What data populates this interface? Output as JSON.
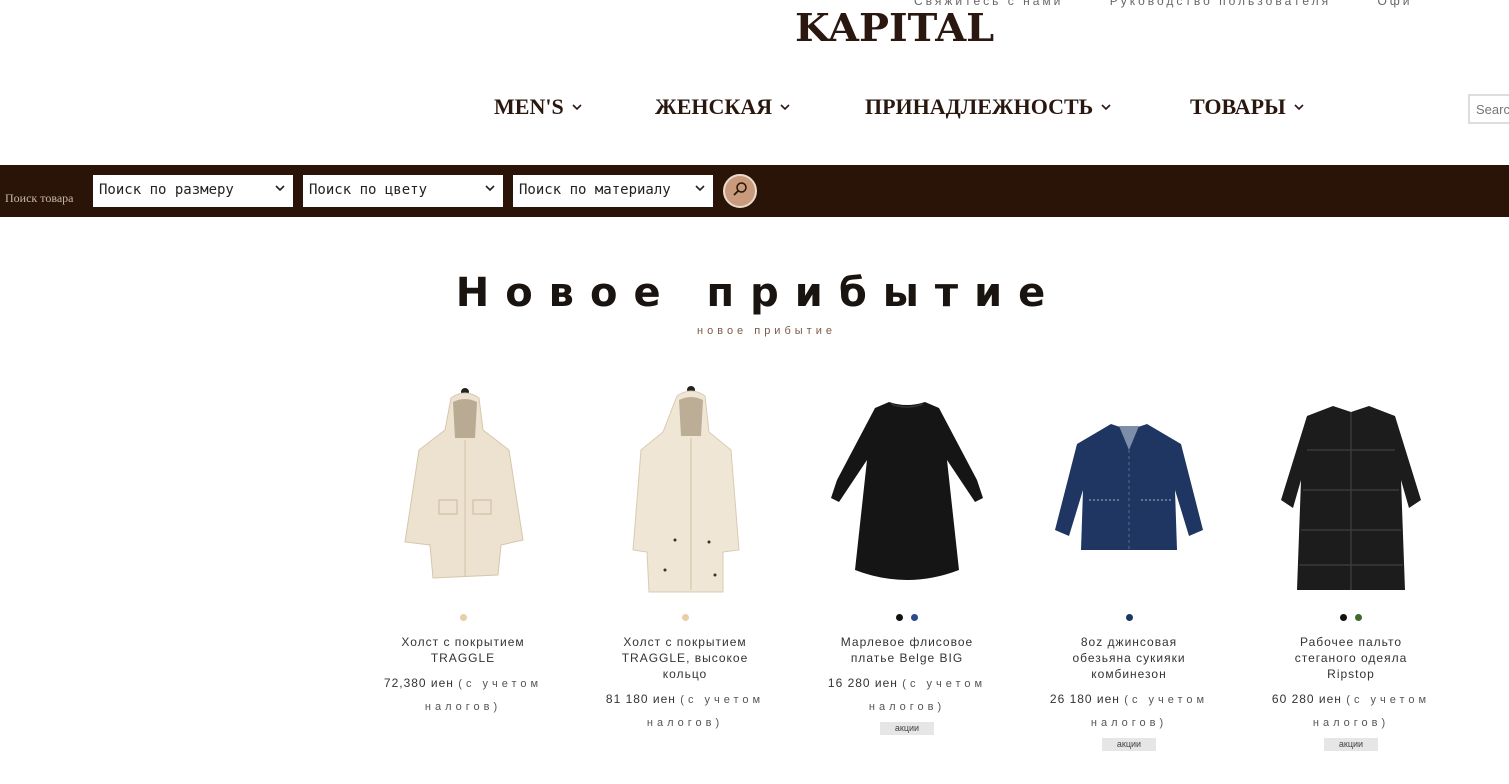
{
  "header": {
    "logo": "KAPITAL",
    "util_links": [
      "Свяжитесь с нами",
      "Руководство пользователя",
      "Офи"
    ],
    "nav": [
      {
        "label": "MEN'S"
      },
      {
        "label": "ЖЕНСКАЯ"
      },
      {
        "label": "ПРИНАДЛЕЖНОСТЬ"
      },
      {
        "label": "ТОВАРЫ"
      }
    ],
    "search_placeholder": "Search"
  },
  "search_bar": {
    "label": "Поиск товара",
    "size_select": "Поиск по размеру",
    "color_select": "Поиск по цвету",
    "material_select": "Поиск по материалу"
  },
  "section": {
    "title": "Новое прибытие",
    "subtitle": "новое прибытие"
  },
  "products": [
    {
      "name": "Холст с покрытием TRAGGLE",
      "price": "72,380 иен",
      "tax": "(с учетом налогов)",
      "colors": [
        "#e8cfa8"
      ],
      "badge": "",
      "image": "cream-parka"
    },
    {
      "name": "Холст с покрытием TRAGGLE, высокое кольцо",
      "price": "81 180 иен",
      "tax": "(с учетом налогов)",
      "colors": [
        "#e8cfa8"
      ],
      "badge": "",
      "image": "cream-long-parka"
    },
    {
      "name": "Марлевое флисовое платье Belge BIG",
      "price": "16 280 иен",
      "tax": "(с учетом налогов)",
      "colors": [
        "#111111",
        "#2a4a8a"
      ],
      "badge": "акции",
      "image": "black-dress"
    },
    {
      "name": "8oz джинсовая обезьяна сукияки комбинезон",
      "price": "26 180 иен",
      "tax": "(с учетом налогов)",
      "colors": [
        "#1f3562"
      ],
      "badge": "акции",
      "image": "denim-jacket"
    },
    {
      "name": "Рабочее пальто стеганого одеяла Ripstop",
      "price": "60 280 иен",
      "tax": "(с учетом налогов)",
      "colors": [
        "#111111",
        "#3c6b2a"
      ],
      "badge": "акции",
      "image": "black-quilted-coat"
    }
  ],
  "icons": {
    "chevron": "chevron-down-icon",
    "search": "search-icon"
  }
}
